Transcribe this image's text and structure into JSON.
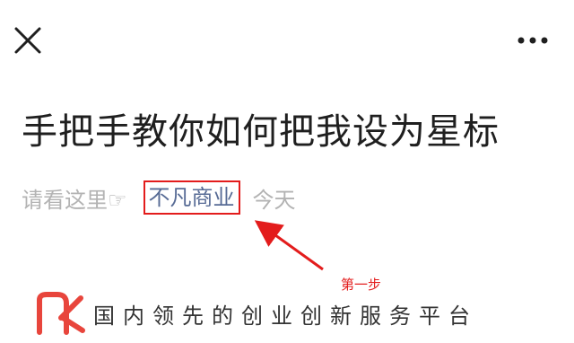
{
  "topbar": {
    "close_icon": "close-icon",
    "more_icon": "more-horizontal-icon"
  },
  "article": {
    "title": "手把手教你如何把我设为星标",
    "meta_prefix": "请看这里☞",
    "account_name": "不凡商业",
    "date": "今天"
  },
  "annotation": {
    "step_label": "第一步",
    "highlight_color": "#e31c1c"
  },
  "brand": {
    "slogan": "国内领先的创业创新服务平台",
    "logo_color": "#e8453c"
  }
}
